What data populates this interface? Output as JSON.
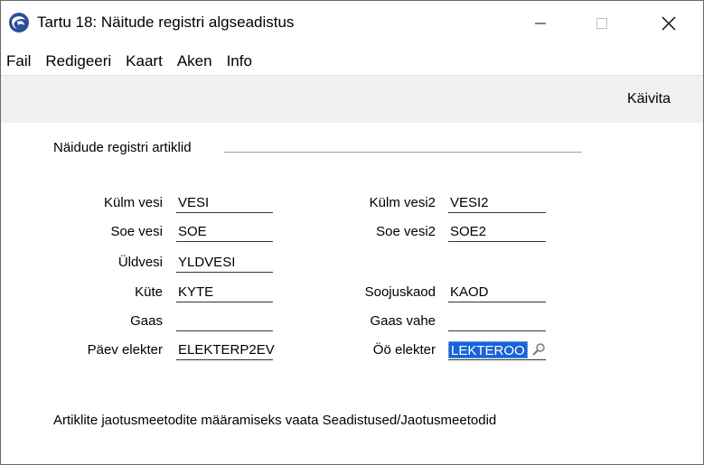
{
  "window": {
    "title": "Tartu 18: Näitude registri algseadistus",
    "icon": "app-globe-icon",
    "controls": [
      "minimize-icon",
      "maximize-icon",
      "close-icon"
    ]
  },
  "menu": [
    "Fail",
    "Redigeeri",
    "Kaart",
    "Aken",
    "Info"
  ],
  "toolbar": {
    "run_label": "Käivita"
  },
  "section": {
    "title": "Näidude registri artiklid"
  },
  "fields": {
    "kulm_vesi": {
      "label": "Külm vesi",
      "value": "VESI"
    },
    "soe_vesi": {
      "label": "Soe vesi",
      "value": "SOE"
    },
    "uldvesi": {
      "label": "Üldvesi",
      "value": "YLDVESI"
    },
    "kute": {
      "label": "Küte",
      "value": "KYTE"
    },
    "gaas": {
      "label": "Gaas",
      "value": ""
    },
    "paev_elekter": {
      "label": "Päev elekter",
      "value": "ELEKTERP2EV"
    },
    "kulm_vesi2": {
      "label": "Külm vesi2",
      "value": "VESI2"
    },
    "soe_vesi2": {
      "label": "Soe vesi2",
      "value": "SOE2"
    },
    "soojuskaod": {
      "label": "Soojuskaod",
      "value": "KAOD"
    },
    "gaas_vahe": {
      "label": "Gaas vahe",
      "value": ""
    },
    "oo_elekter": {
      "label": "Öö elekter",
      "value": "LEKTEROO"
    }
  },
  "footer": {
    "note": "Artiklite jaotusmeetodite määramiseks vaata Seadistused/Jaotusmeetodid"
  },
  "colors": {
    "selection": "#1a63d6",
    "toolbar_bg": "#f1f1f1"
  }
}
